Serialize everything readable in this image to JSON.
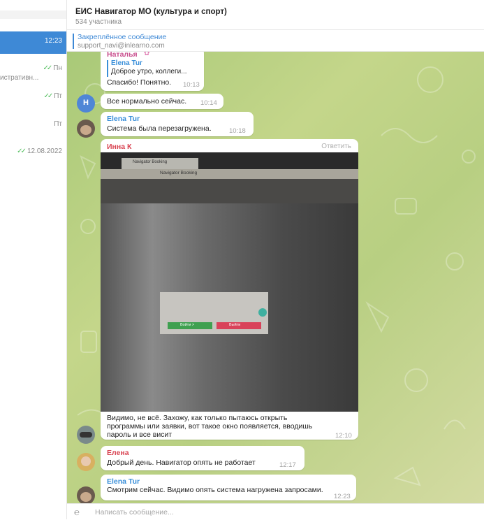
{
  "left_list": [
    {
      "time": "",
      "preview": ""
    },
    {
      "time": "12:23",
      "active": true
    },
    {
      "time": "Пн",
      "preview": "истративн..."
    },
    {
      "time": "Пт"
    },
    {
      "time": "Пт"
    },
    {
      "time": "12.08.2022"
    }
  ],
  "header": {
    "title": "ЕИС Навигатор МО (культура и спорт)",
    "subtitle": "534 участника"
  },
  "pinned": {
    "title": "Закреплённое сообщение",
    "text": "support_navi@inlearno.com"
  },
  "messages": [
    {
      "sender": "Наталья",
      "reply_sender": "Elena Tur",
      "reply_text": "Доброе утро, коллеги...",
      "text": "Спасибо! Понятно.",
      "time": "10:13"
    },
    {
      "avatar_letter": "Н",
      "text": "Все нормально сейчас.",
      "time": "10:14"
    },
    {
      "sender": "Elena Tur",
      "text": "Система была перезагружена.",
      "time": "10:18"
    },
    {
      "sender": "Инна К",
      "reply_action": "Ответить",
      "photo": {
        "tab": "Navigator Booking",
        "page_title": "Navigator Booking",
        "button1": "Войти >",
        "button2": "Выйти"
      },
      "text_lines": [
        "Видимо, не всё. Захожу, как только пытаюсь открыть",
        "программы или заявки, вот такое окно появляется, вводишь",
        "пароль и все висит"
      ],
      "time": "12:10"
    },
    {
      "sender": "Елена",
      "text": "Добрый день. Навигатор опять не работает",
      "time": "12:17"
    },
    {
      "sender": "Elena Tur",
      "text": "Смотрим сейчас. Видимо опять система нагружена запросами.",
      "time": "12:23"
    }
  ],
  "input": {
    "placeholder": "Написать сообщение..."
  },
  "colors": {
    "accent": "#3e89d6",
    "sender_blue": "#3a8fd9",
    "sender_red": "#d94452",
    "sender_pink": "#c94f8e",
    "check": "#4ebd5a"
  }
}
